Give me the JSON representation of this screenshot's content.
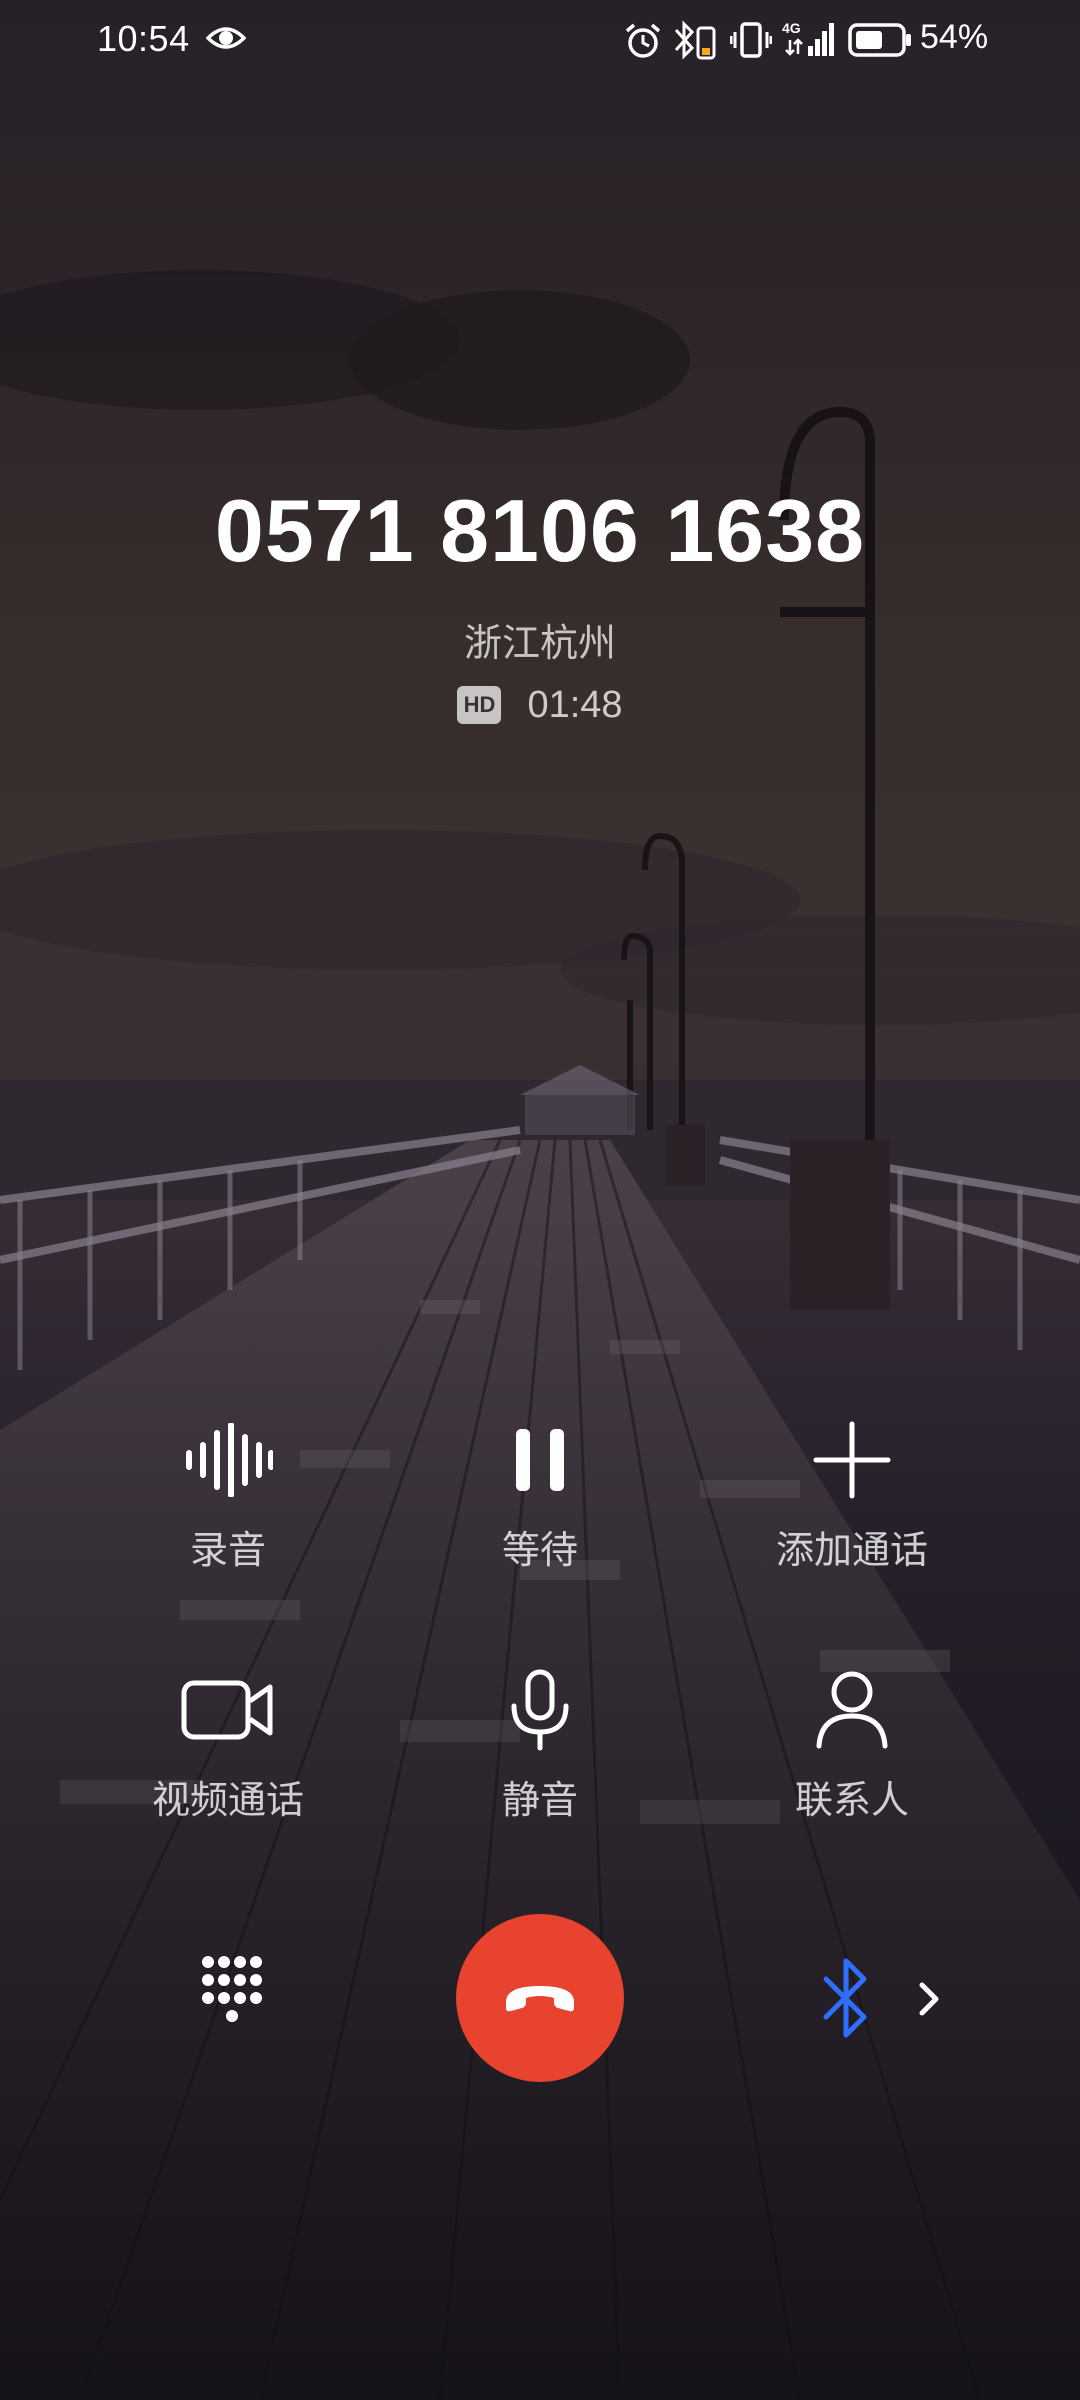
{
  "status_bar": {
    "time": "10:54",
    "battery_percent": "54%",
    "network_label": "4G",
    "icons": [
      "eye-icon",
      "alarm-icon",
      "bluetooth-battery-icon",
      "vibrate-icon",
      "signal-icon",
      "battery-icon"
    ]
  },
  "call": {
    "number": "0571 8106 1638",
    "location": "浙江杭州",
    "hd_badge": "HD",
    "duration": "01:48"
  },
  "actions": [
    {
      "label": "录音",
      "icon": "record-waveform-icon"
    },
    {
      "label": "等待",
      "icon": "pause-icon"
    },
    {
      "label": "添加通话",
      "icon": "add-call-icon"
    },
    {
      "label": "视频通话",
      "icon": "video-call-icon"
    },
    {
      "label": "静音",
      "icon": "microphone-icon"
    },
    {
      "label": "联系人",
      "icon": "contacts-icon"
    }
  ],
  "bottom": {
    "dialpad_icon": "dialpad-icon",
    "end_call_icon": "end-call-icon",
    "audio_route_icon": "bluetooth-icon"
  },
  "colors": {
    "end_call": "#e8432f",
    "bluetooth": "#2f6fff"
  }
}
